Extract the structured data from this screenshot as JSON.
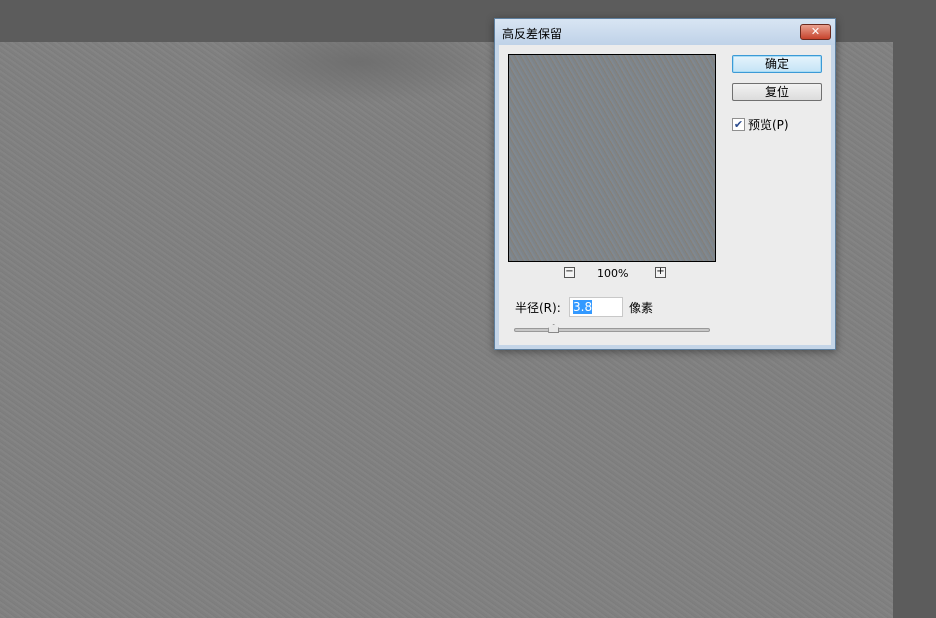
{
  "dialog": {
    "title": "高反差保留",
    "close_label": "✕",
    "ok_label": "确定",
    "reset_label": "复位",
    "preview_checkbox": {
      "label": "预览(P)",
      "checked": true
    },
    "zoom": {
      "minus": "−",
      "plus": "+",
      "level": "100%"
    },
    "radius": {
      "label": "半径(R):",
      "value": "3.8",
      "unit": "像素",
      "slider_fraction": 0.2
    }
  }
}
